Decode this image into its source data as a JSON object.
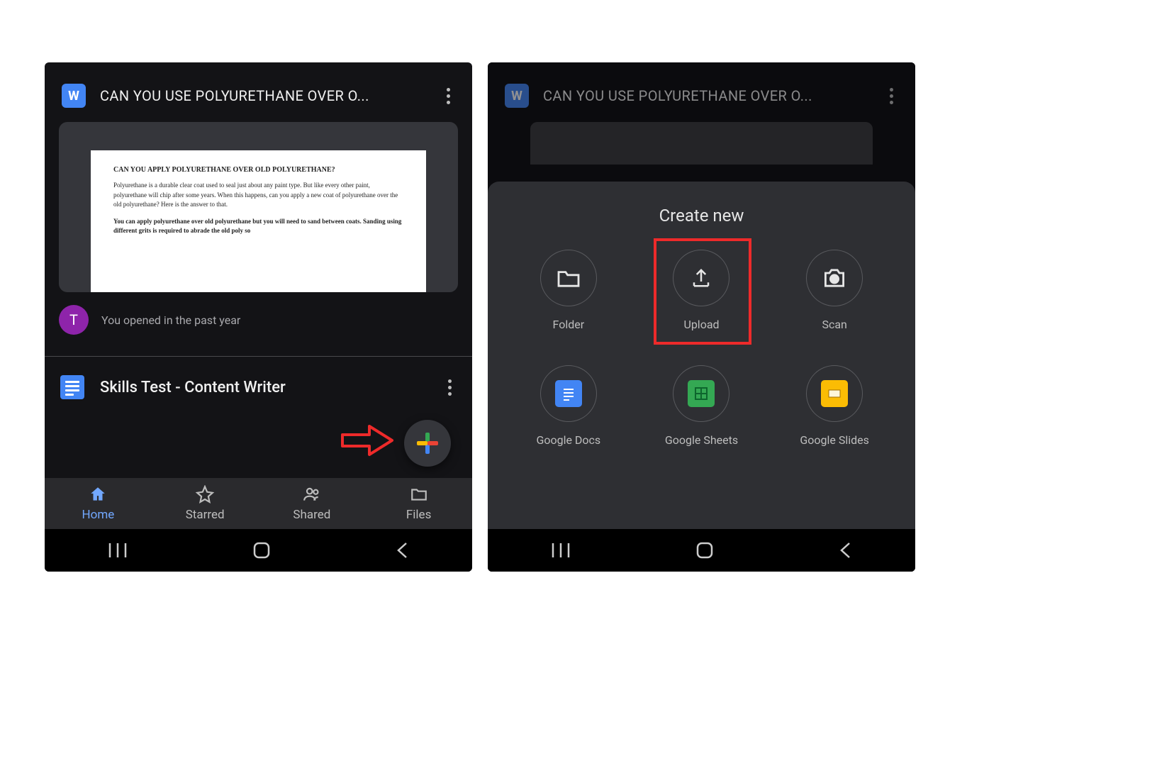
{
  "left": {
    "fileTitle": "CAN YOU USE POLYURETHANE OVER O...",
    "wordBadge": "W",
    "doc": {
      "heading": "CAN YOU APPLY POLYURETHANE OVER OLD POLYURETHANE?",
      "para": "Polyurethane is a durable clear coat used to seal just about any paint type. But like every other paint, polyurethane will chip after some years. When this happens, can you apply a new coat of polyurethane over the old polyurethane? Here is the answer to that.",
      "bold": "You can apply polyurethane over old polyurethane but you will need to sand between coats. Sanding using different grits is required to abrade the old poly so"
    },
    "avatarLetter": "T",
    "openedText": "You opened in the past year",
    "secondFile": "Skills Test - Content Writer",
    "nav": {
      "home": "Home",
      "starred": "Starred",
      "shared": "Shared",
      "files": "Files"
    }
  },
  "right": {
    "fileTitle": "CAN YOU USE POLYURETHANE OVER O...",
    "wordBadge": "W",
    "sheetTitle": "Create new",
    "items": {
      "folder": "Folder",
      "upload": "Upload",
      "scan": "Scan",
      "docs": "Google Docs",
      "sheets": "Google Sheets",
      "slides": "Google Slides"
    }
  }
}
